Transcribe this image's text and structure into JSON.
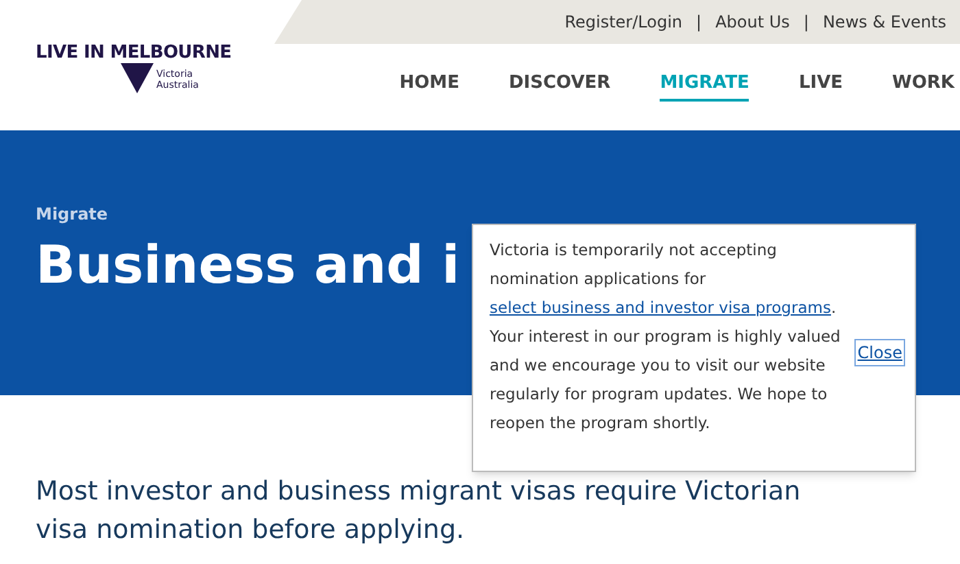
{
  "top_links": [
    "Register/Login",
    "About Us",
    "News & Events"
  ],
  "top_link_separator": "|",
  "logo": {
    "title": "LIVE IN MELBOURNE",
    "subtitle_lines": [
      "Victoria",
      "Australia"
    ]
  },
  "nav": [
    {
      "label": "HOME",
      "selected": false
    },
    {
      "label": "DISCOVER",
      "selected": false
    },
    {
      "label": "MIGRATE",
      "selected": true
    },
    {
      "label": "LIVE",
      "selected": false
    },
    {
      "label": "WORK",
      "selected": false
    }
  ],
  "hero": {
    "breadcrumb": "Migrate",
    "title": "Business and i"
  },
  "popup": {
    "text_before": "Victoria is temporarily not accepting nomination applications for ",
    "link": "select business and investor visa programs",
    "text_after": ". Your interest in our program is highly valued and we encourage you to visit our website regularly for program updates. We hope to reopen the program shortly.",
    "close": "Close"
  },
  "intro": "Most investor and business migrant visas require Victorian visa nomination before applying."
}
